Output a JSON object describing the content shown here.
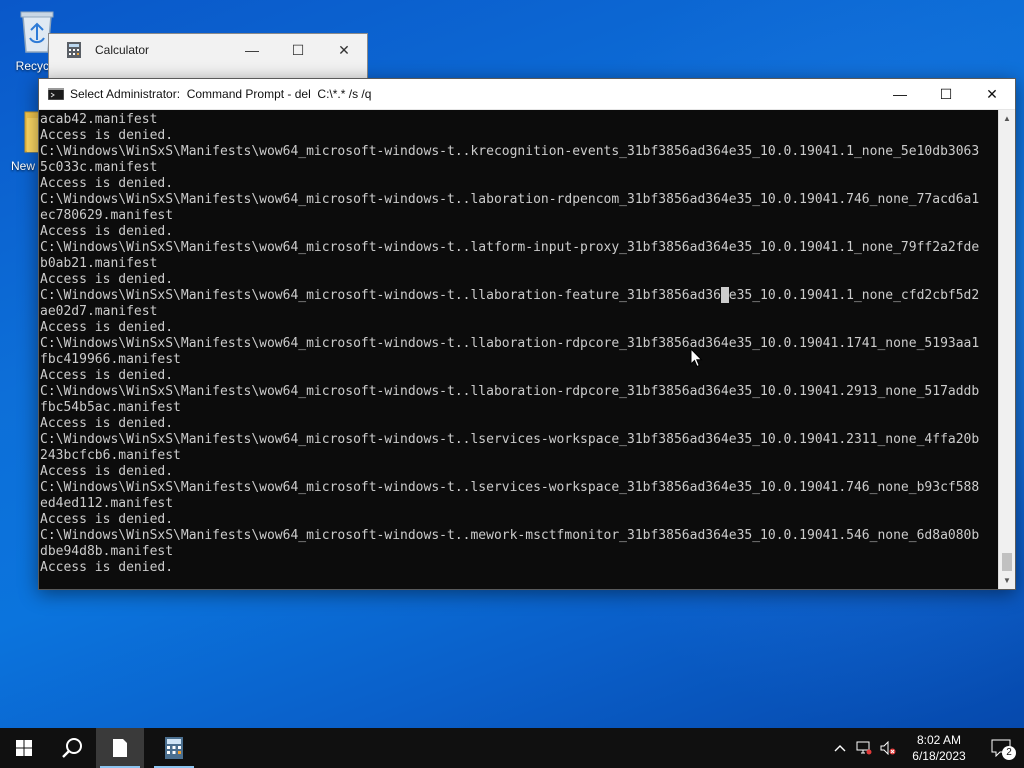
{
  "desktop": {
    "icons": [
      {
        "label": "Recycle"
      },
      {
        "label": "New"
      }
    ]
  },
  "calculator_window": {
    "title": "Calculator",
    "minimize": "—",
    "maximize": "☐",
    "close": "✕"
  },
  "cmd_window": {
    "title": "Select Administrator:  Command Prompt - del  C:\\*.* /s /q",
    "minimize": "—",
    "maximize": "☐",
    "close": "✕",
    "lines": [
      "acab42.manifest",
      "Access is denied.",
      "C:\\Windows\\WinSxS\\Manifests\\wow64_microsoft-windows-t..krecognition-events_31bf3856ad364e35_10.0.19041.1_none_5e10db3063",
      "5c033c.manifest",
      "Access is denied.",
      "C:\\Windows\\WinSxS\\Manifests\\wow64_microsoft-windows-t..laboration-rdpencom_31bf3856ad364e35_10.0.19041.746_none_77acd6a1",
      "ec780629.manifest",
      "Access is denied.",
      "C:\\Windows\\WinSxS\\Manifests\\wow64_microsoft-windows-t..latform-input-proxy_31bf3856ad364e35_10.0.19041.1_none_79ff2a2fde",
      "b0ab21.manifest",
      "Access is denied.",
      "C:\\Windows\\WinSxS\\Manifests\\wow64_microsoft-windows-t..llaboration-feature_31bf3856ad364e35_10.0.19041.1_none_cfd2cbf5d2",
      "ae02d7.manifest",
      "Access is denied.",
      "C:\\Windows\\WinSxS\\Manifests\\wow64_microsoft-windows-t..llaboration-rdpcore_31bf3856ad364e35_10.0.19041.1741_none_5193aa1",
      "fbc419966.manifest",
      "Access is denied.",
      "C:\\Windows\\WinSxS\\Manifests\\wow64_microsoft-windows-t..llaboration-rdpcore_31bf3856ad364e35_10.0.19041.2913_none_517addb",
      "fbc54b5ac.manifest",
      "Access is denied.",
      "C:\\Windows\\WinSxS\\Manifests\\wow64_microsoft-windows-t..lservices-workspace_31bf3856ad364e35_10.0.19041.2311_none_4ffa20b",
      "243bcfcb6.manifest",
      "Access is denied.",
      "C:\\Windows\\WinSxS\\Manifests\\wow64_microsoft-windows-t..lservices-workspace_31bf3856ad364e35_10.0.19041.746_none_b93cf588",
      "ed4ed112.manifest",
      "Access is denied.",
      "C:\\Windows\\WinSxS\\Manifests\\wow64_microsoft-windows-t..mework-msctfmonitor_31bf3856ad364e35_10.0.19041.546_none_6d8a080b",
      "dbe94d8b.manifest",
      "Access is denied."
    ]
  },
  "taskbar": {
    "clock_time": "8:02 AM",
    "clock_date": "6/18/2023",
    "notification_count": "2",
    "icons": [
      "windows-start-icon",
      "search-icon",
      "file-icon",
      "calculator-icon",
      "chevron-up-icon",
      "network-icon",
      "volume-muted-icon",
      "notification-icon"
    ]
  },
  "colors": {
    "console_bg": "#0c0c0c",
    "console_text": "#cccccc",
    "taskbar_bg": "#101010",
    "desktop_accent": "#0b74dd"
  }
}
